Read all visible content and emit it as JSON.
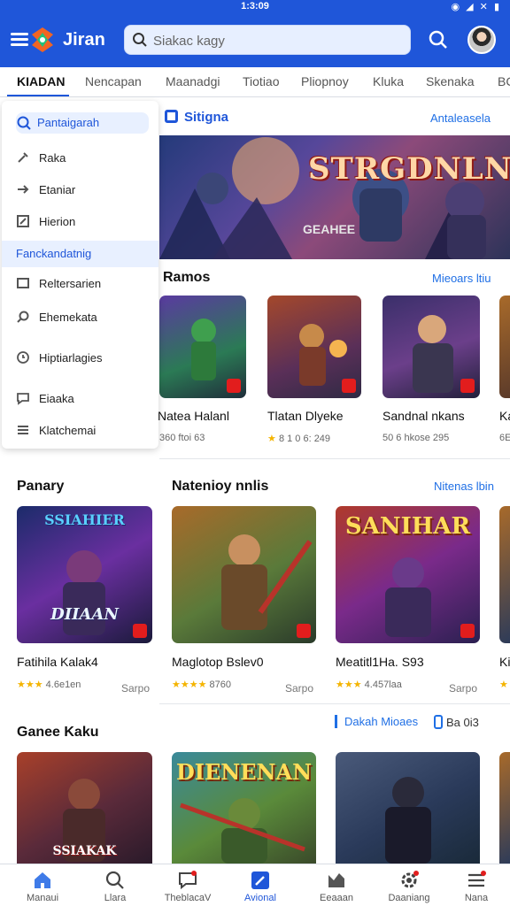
{
  "status_bar": {
    "time": "1:3:09",
    "icons": "◉ ◢ ✕ ▮"
  },
  "header": {
    "title": "Jiran",
    "search_placeholder": "Siakac kagy",
    "brand_color": "#1f56d9"
  },
  "tabs": [
    {
      "label": "KIADAN",
      "active": true
    },
    {
      "label": "Nencapan",
      "active": false
    },
    {
      "label": "Maanadgi",
      "active": false
    },
    {
      "label": "Tiotiao",
      "active": false
    },
    {
      "label": "Pliopnoy",
      "active": false
    },
    {
      "label": "Kluka",
      "active": false
    },
    {
      "label": "Skenaka",
      "active": false
    },
    {
      "label": "BC",
      "active": false
    }
  ],
  "drawer": {
    "search_label": "Pantaigarah",
    "items": [
      {
        "label": "Raka",
        "icon": "tool-icon"
      },
      {
        "label": "Etaniar",
        "icon": "arrow-right-icon"
      },
      {
        "label": "Hierion",
        "icon": "edit-icon"
      },
      {
        "label": "Fanckandatnig",
        "icon": "none",
        "highlight": true
      },
      {
        "label": "Reltersarien",
        "icon": "square-icon"
      },
      {
        "label": "Ehemekata",
        "icon": "search-icon"
      },
      {
        "label": "Hiptiarlagies",
        "icon": "clock-icon"
      },
      {
        "label": "Eiaaka",
        "icon": "message-icon"
      },
      {
        "label": "Klatchemai",
        "icon": "list-icon"
      }
    ]
  },
  "featured": {
    "label": "Sitigna",
    "see_all": "Antaleasela",
    "banner_title": "STRGDNLNEN",
    "banner_sub": "GEAHEE"
  },
  "ramos": {
    "heading": "Ramos",
    "see_all": "Mieoars ltiu",
    "games": [
      {
        "name": "Natea Halanl",
        "meta": "360 ftoi 63"
      },
      {
        "name": "Tlatan Dlyeke",
        "meta": "8 1 0 6: 249",
        "stars": "★"
      },
      {
        "name": "Sandnal nkans",
        "meta": "50 6 hkose 295"
      },
      {
        "name": "Ka",
        "meta": "6E"
      }
    ]
  },
  "panary": {
    "heading_left": "Panary",
    "heading": "Natenioy nnlis",
    "see_all": "Nitenas lbin",
    "games": [
      {
        "name": "Fatihila Kalak4",
        "stars": "★★★",
        "rating": "4.6e1en",
        "right": "Sarpo",
        "art_title": "SSIAHIER",
        "art_sub": "DIIAAN"
      },
      {
        "name": "Maglotop Bslev0",
        "stars": "★★★★",
        "rating": "8760",
        "right": "Sarpo",
        "art_title": "",
        "art_sub": ""
      },
      {
        "name": "Meatitl1Ha. S93",
        "stars": "★★★",
        "rating": "4.457laa",
        "right": "Sarpo",
        "art_title": "SANIHAR",
        "art_sub": ""
      },
      {
        "name": "Ki",
        "stars": "★",
        "rating": "",
        "right": "",
        "art_title": "",
        "art_sub": ""
      }
    ]
  },
  "ganee": {
    "heading": "Ganee Kaku",
    "filter": "Dakah Mioaes",
    "filter2": "Ba 0i3",
    "art_titles": [
      "SSIAKAK",
      "DIENENAN",
      ""
    ]
  },
  "bottom_nav": [
    {
      "label": "Manaui",
      "icon": "home-icon",
      "active": false
    },
    {
      "label": "Llara",
      "icon": "search-icon",
      "active": false
    },
    {
      "label": "TheblacaV",
      "icon": "chat-icon",
      "active": false
    },
    {
      "label": "Avional",
      "icon": "edit-icon",
      "active": true
    },
    {
      "label": "Eeaaan",
      "icon": "store-icon",
      "active": false
    },
    {
      "label": "Daaniang",
      "icon": "settings-icon",
      "active": false
    },
    {
      "label": "Nana",
      "icon": "menu-icon",
      "active": false
    }
  ]
}
